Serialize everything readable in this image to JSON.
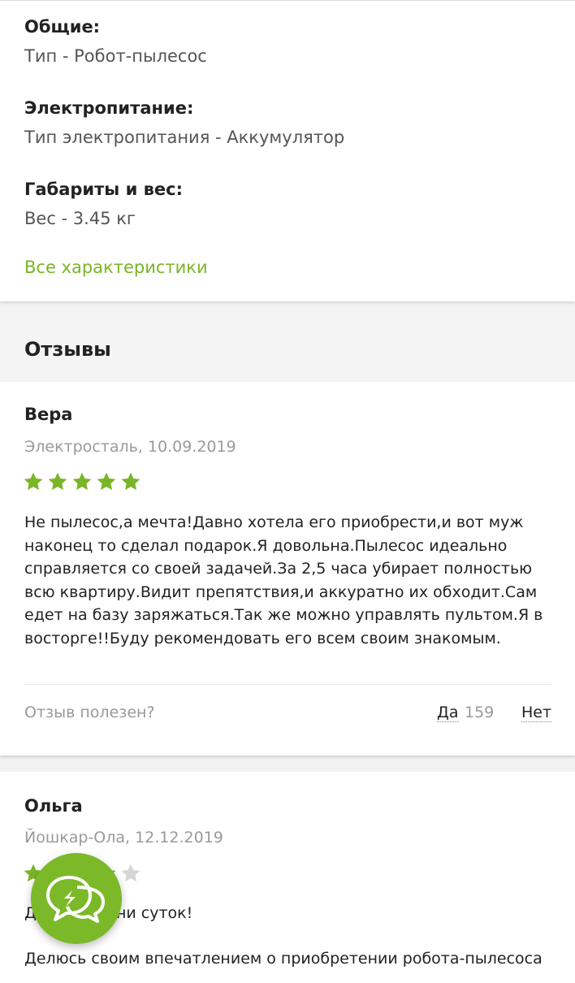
{
  "specs": {
    "groups": [
      {
        "heading": "Общие:",
        "value": "Тип - Робот-пылесос"
      },
      {
        "heading": "Электропитание:",
        "value": "Тип электропитания - Аккумулятор"
      },
      {
        "heading": "Габариты и вес:",
        "value": "Вес - 3.45 кг"
      }
    ],
    "all_link": "Все характеристики"
  },
  "reviews": {
    "title": "Отзывы",
    "items": [
      {
        "author": "Вера",
        "meta": "Электросталь, 10.09.2019",
        "rating": 5,
        "text": "Не пылесос,а мечта!Давно хотела его приобрести,и вот муж наконец то сделал подарок.Я довольна.Пылесос идеально справляется со своей задачей.За 2,5 часа убирает полностью всю квартиру.Видит препятствия,и аккуратно их обходит.Сам едет на базу заряжаться.Так же можно управлять пультом.Я в восторге!!Буду рекомендовать его всем своим знакомым.",
        "helpful_label": "Отзыв полезен?",
        "yes_label": "Да",
        "yes_count": "159",
        "no_label": "Нет"
      },
      {
        "author": "Ольга",
        "meta": "Йошкар-Ола, 12.12.2019",
        "rating": 4,
        "text_line1": "Д          емени суток!",
        "text_line2": "Делюсь своим впечатлением о приобретении робота-пылесоса"
      }
    ]
  },
  "colors": {
    "accent": "#7ab527",
    "star_empty": "#d6d6d6"
  },
  "chat_button": {
    "icon": "chat-bubbles-icon"
  }
}
